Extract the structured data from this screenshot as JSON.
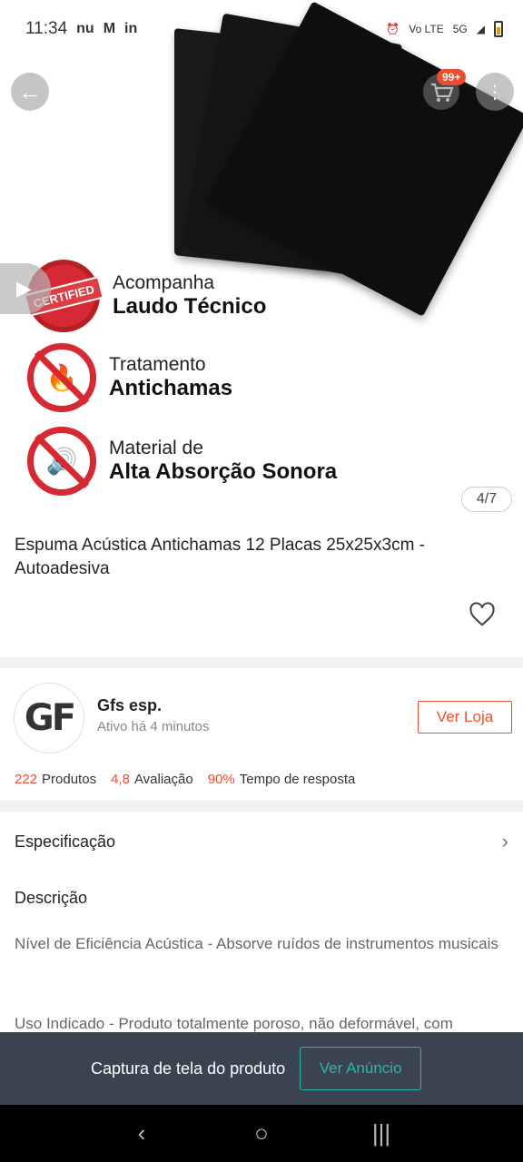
{
  "status_bar": {
    "time": "11:34",
    "network": "5G",
    "volte": "Vo LTE"
  },
  "hero": {
    "image_counter": "4/7",
    "cart_badge": "99+",
    "features": [
      {
        "line1": "Acompanha",
        "line2": "Laudo Técnico",
        "badge": "CERTIFIED"
      },
      {
        "line1": "Tratamento",
        "line2": "Antichamas"
      },
      {
        "line1": "Material de",
        "line2": "Alta Absorção Sonora"
      }
    ]
  },
  "product": {
    "title": "Espuma Acústica Antichamas 12 Placas 25x25x3cm - Autoadesiva"
  },
  "seller": {
    "logo_text": "GF",
    "name": "Gfs esp.",
    "status": "Ativo há 4 minutos",
    "view_store_label": "Ver Loja",
    "stats": [
      {
        "value": "222",
        "label": "Produtos"
      },
      {
        "value": "4,8",
        "label": "Avaliação"
      },
      {
        "value": "90%",
        "label": "Tempo de resposta"
      }
    ]
  },
  "details": {
    "spec_label": "Especificação",
    "desc_label": "Descrição",
    "desc_paragraph1": "Nível de Eficiência Acústica - Absorve ruídos de instrumentos musicais",
    "desc_paragraph2": "Uso Indicado - Produto totalmente poroso, não deformável, com"
  },
  "capture_bar": {
    "text": "Captura de tela do produto",
    "button": "Ver Anúncio"
  },
  "colors": {
    "accent": "#ee4d2d",
    "capture_bar_bg": "#3a4350",
    "capture_button": "#2bb5a8"
  }
}
